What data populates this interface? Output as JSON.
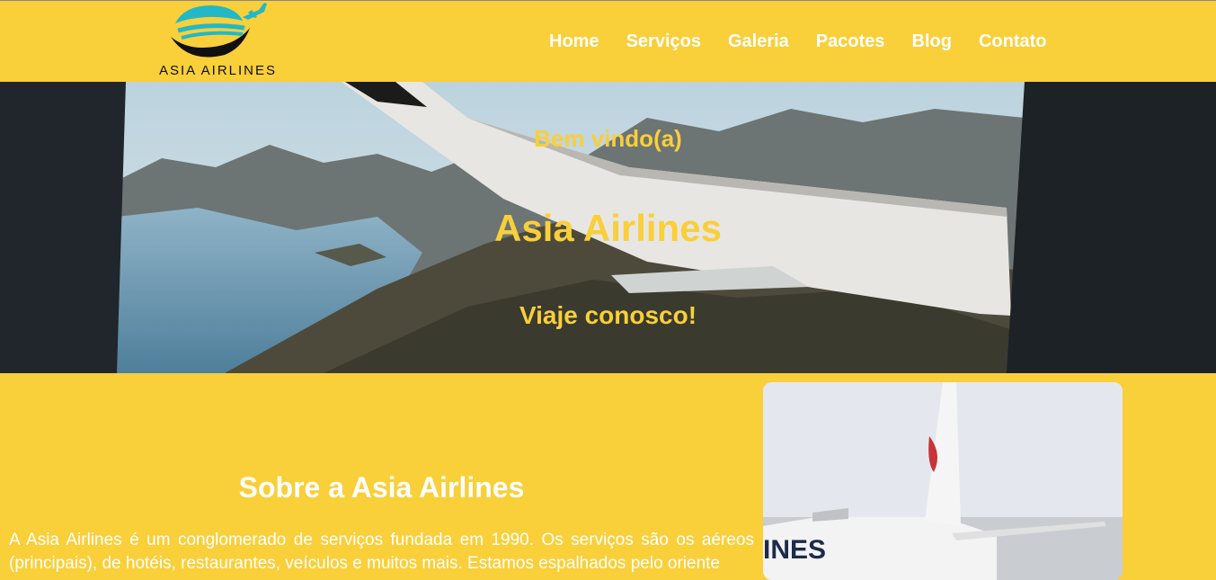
{
  "brand": {
    "name": "ASIA AIRLINES",
    "colors": {
      "accent": "#f9cf3a",
      "logo_teal": "#22b8c8"
    }
  },
  "nav": {
    "items": [
      {
        "label": "Home"
      },
      {
        "label": "Serviços"
      },
      {
        "label": "Galeria"
      },
      {
        "label": "Pacotes"
      },
      {
        "label": "Blog"
      },
      {
        "label": "Contato"
      }
    ]
  },
  "hero": {
    "welcome": "Bem vindo(a)",
    "title": "Asia Airlines",
    "tagline": "Viaje conosco!"
  },
  "about": {
    "title": "Sobre a Asia Airlines",
    "body": "A Asia Airlines é um conglomerado de serviços fundada em 1990. Os serviços são os aéreos (principais), de hotéis, restaurantes, veículos e muitos mais. Estamos espalhados pelo oriente"
  }
}
